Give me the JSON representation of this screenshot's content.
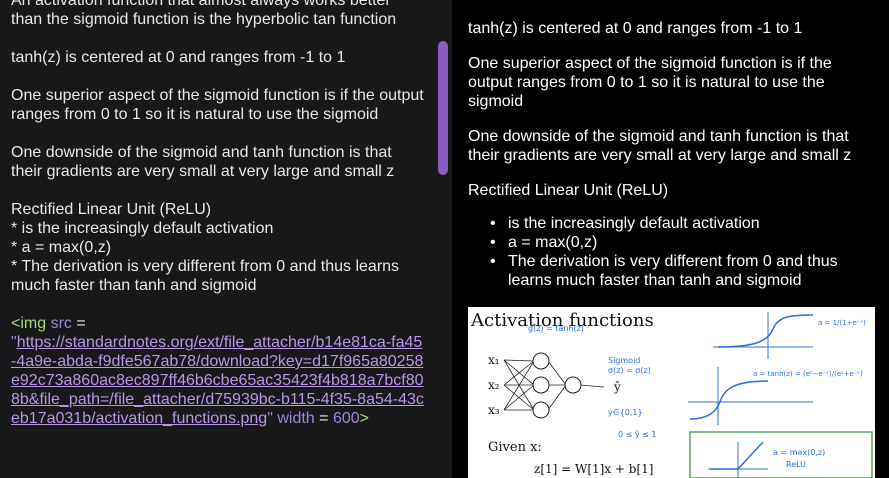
{
  "editor": {
    "para1_line1": "An activation function that almost always works better",
    "para1_line2": "than the sigmoid function is the hyperbolic tan function",
    "para2": "tanh(z) is centered at 0 and ranges from -1 to 1",
    "para3_line1": "One superior aspect of the sigmoid function is if the output",
    "para3_line2": "ranges from 0 to 1 so it is natural to use the sigmoid",
    "para4_line1": "One downside of the sigmoid and tanh function is that",
    "para4_line2": "their gradients are very small at very large and small z",
    "relu_heading": "Rectified Linear Unit (ReLU)",
    "relu_item1": "* is the increasingly default activation",
    "relu_item2": "* a = max(0,z)",
    "relu_item3_line1": "* The derivation is very different from 0 and thus learns",
    "relu_item3_line2": "much faster than tanh and sigmoid",
    "img_open": "<img",
    "img_src_attr": "src",
    "img_eq": " =",
    "img_quote_open": "\"",
    "img_url": "https://standardnotes.org/ext/file_attacher/b14e81ca-fa45-4a9e-abda-f9dfe567ab78/download?key=d17f965a80258e92c73a860ac8ec897ff46b6cbe65ac35423f4b818a7bcf808b&file_path=/file_attacher/d75939bc-b115-4f35-8a54-43ceb17a031b/activation_functions.png",
    "img_quote_close": "\"",
    "img_width_attr": "width",
    "img_width_eq": " = ",
    "img_width_value": "600",
    "img_close": ">"
  },
  "preview": {
    "line_tanh": "tanh(z) is centered at 0 and ranges from -1 to 1",
    "para_sigmoid": "One superior aspect of the sigmoid function is if the output ranges from 0 to 1 so it is natural to use the sigmoid",
    "para_downside": "One downside of the sigmoid and tanh function is that their gradients are very small at very large and small z",
    "relu_heading": "Rectified Linear Unit (ReLU)",
    "bullets": [
      "is the increasingly default activation",
      "a = max(0,z)",
      "The derivation is very different from 0 and thus learns much faster than tanh and sigmoid"
    ],
    "figure": {
      "title": "Activation functions",
      "x1": "x₁",
      "x2": "x₂",
      "x3": "x₃",
      "given": "Given x:",
      "equation": "z[1] = W[1]x + b[1]",
      "note_g": "g(z) = tanh(z)",
      "note_sigmoid": "Sigmoid",
      "note_sigma": "σ(z) = σ(z)",
      "note_y": "y∈{0,1}",
      "note_range": "0 ≤ ŷ ≤ 1",
      "label_a_sig": "a = 1/(1+e⁻ᶻ)",
      "label_a_tanh": "a = tanh(z) = (eᶻ−e⁻ᶻ)/(eᶻ+e⁻ᶻ)",
      "label_relu_a": "a = max(0,z)",
      "label_relu": "ReLU"
    }
  }
}
